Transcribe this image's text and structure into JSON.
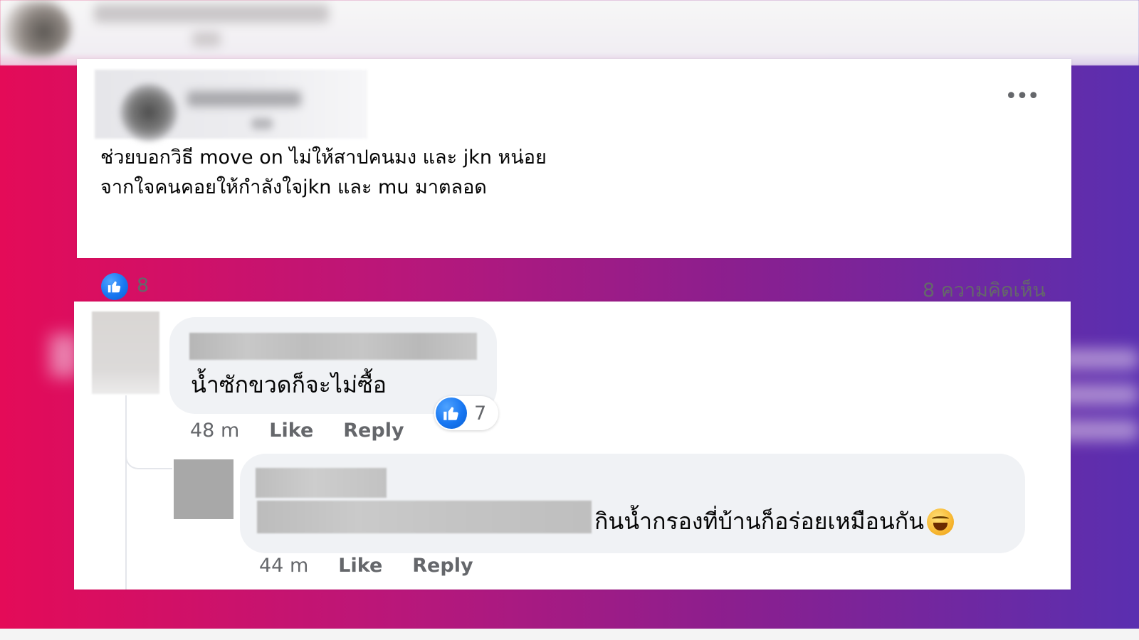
{
  "colors": {
    "accent": "#1877f2",
    "secondary_text": "#65676b",
    "bubble": "#f0f2f5"
  },
  "post": {
    "line1": "ช่วยบอกวิธี move on ไม่ให้สาปคนมง และ jkn หน่อย",
    "line2": "จากใจคนคอยให้กำลังใจjkn และ mu มาตลอด",
    "like_count": "8",
    "comment_count": "8 ความคิดเห็น",
    "more_label": "•••",
    "like_icon": "thumbs-up-icon"
  },
  "comments": [
    {
      "text": "น้ำซักขวดก็จะไม่ซื้อ",
      "time": "48 m",
      "like_label": "Like",
      "reply_label": "Reply",
      "reaction_count": "7"
    },
    {
      "text": "กินน้ำกรองที่บ้านก็อร่อยเหมือนกัน",
      "emoji": "grinning-squinting-face-icon",
      "time": "44 m",
      "like_label": "Like",
      "reply_label": "Reply"
    }
  ]
}
